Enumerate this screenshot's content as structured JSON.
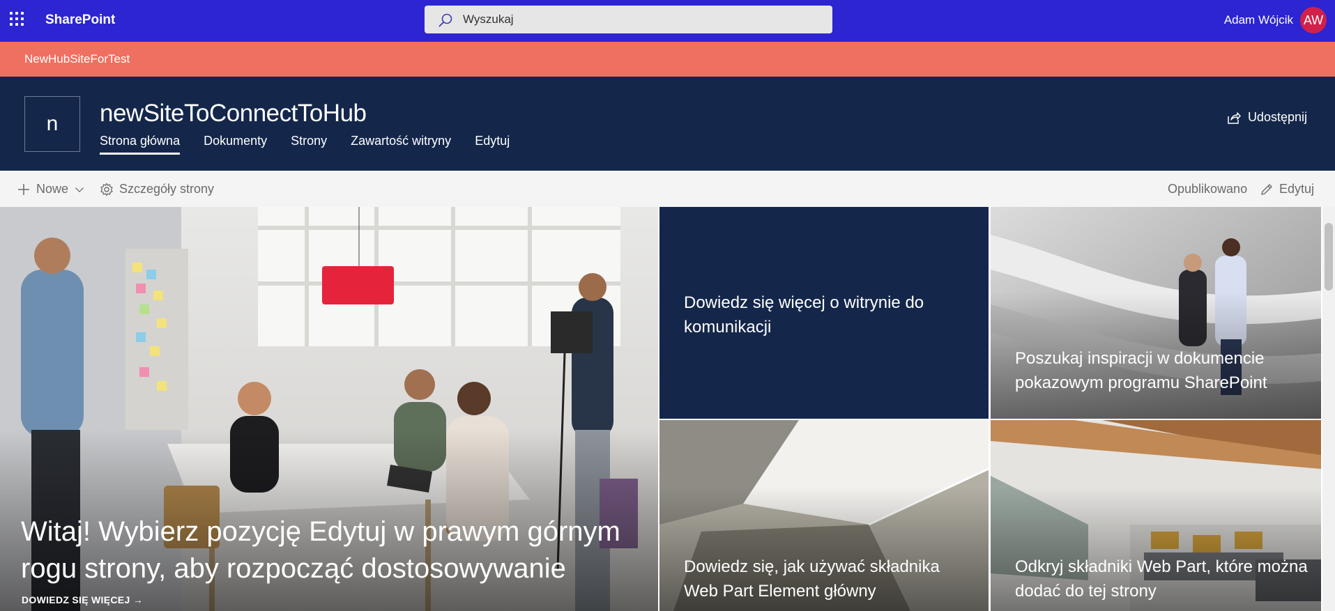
{
  "suite": {
    "app_name": "SharePoint",
    "search_placeholder": "Wyszukaj",
    "user_name": "Adam Wójcik",
    "user_initials": "AW"
  },
  "hub": {
    "name": "NewHubSiteForTest"
  },
  "site": {
    "logo_letter": "n",
    "title": "newSiteToConnectToHub",
    "nav": [
      {
        "label": "Strona główna",
        "active": true
      },
      {
        "label": "Dokumenty",
        "active": false
      },
      {
        "label": "Strony",
        "active": false
      },
      {
        "label": "Zawartość witryny",
        "active": false
      },
      {
        "label": "Edytuj",
        "active": false
      }
    ],
    "share_label": "Udostępnij"
  },
  "commandbar": {
    "new_label": "Nowe",
    "details_label": "Szczegóły strony",
    "status_label": "Opublikowano",
    "edit_label": "Edytuj"
  },
  "hero": {
    "main_title": "Witaj! Wybierz pozycję Edytuj w prawym górnym rogu strony, aby rozpocząć dostosowywanie",
    "main_link": "DOWIEDZ SIĘ WIĘCEJ",
    "tiles": [
      {
        "title": "Dowiedz się więcej o witrynie do komunikacji"
      },
      {
        "title": "Poszukaj inspiracji w dokumencie pokazowym programu SharePoint"
      },
      {
        "title": "Dowiedz się, jak używać składnika Web Part Element główny"
      },
      {
        "title": "Odkryj składniki Web Part, które można dodać do tej strony"
      }
    ]
  },
  "colors": {
    "suite_bar": "#2c25d1",
    "hub_bar": "#ef7060",
    "site_header": "#14274a",
    "avatar": "#d1204a"
  }
}
